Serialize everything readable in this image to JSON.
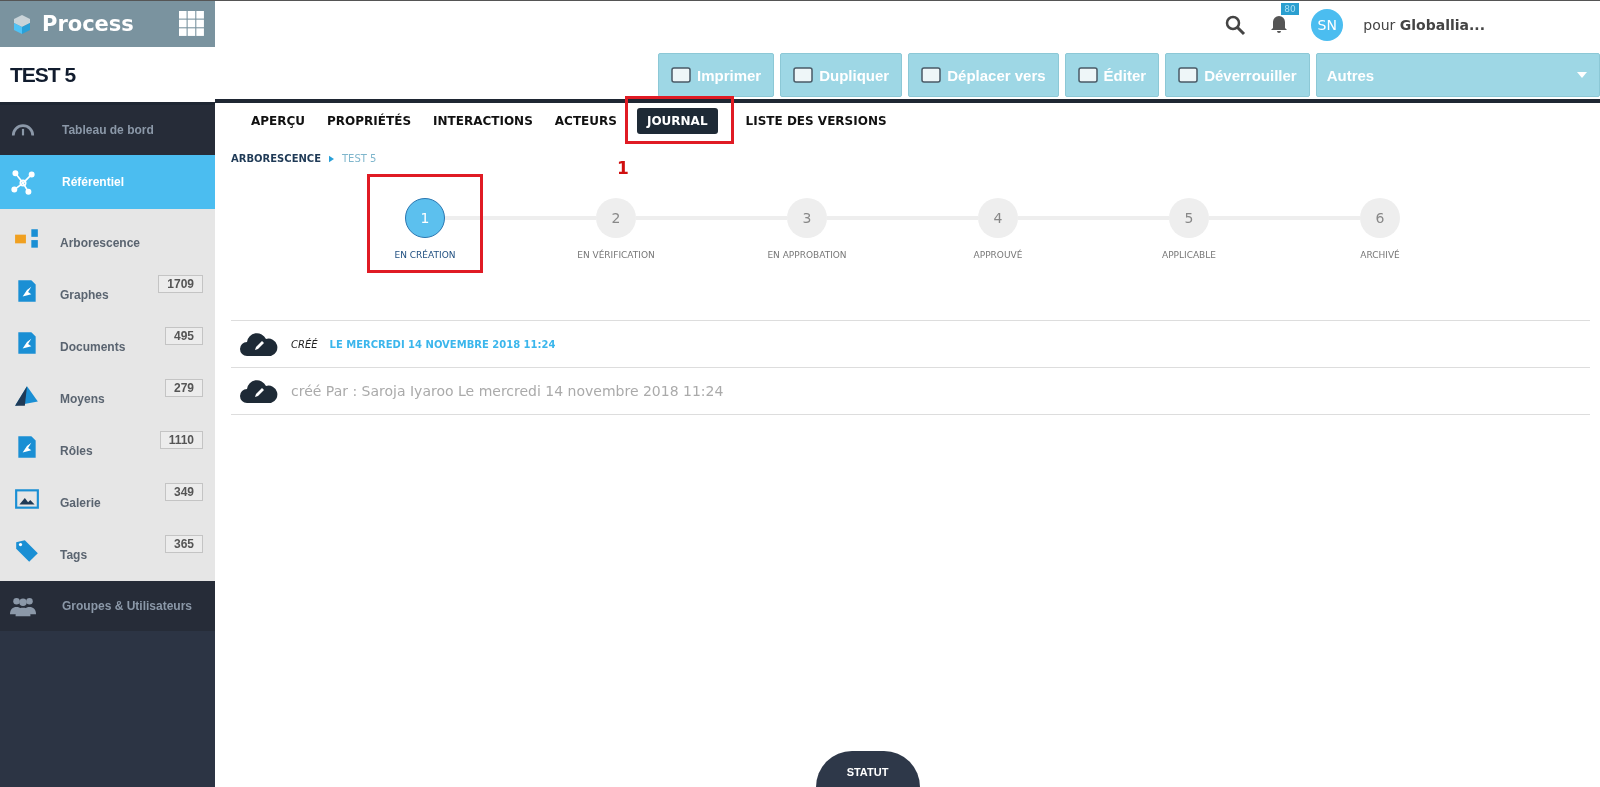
{
  "app": {
    "name": "Process"
  },
  "page_title": "TEST 5",
  "topbar": {
    "notification_count": "80",
    "avatar_initials": "SN",
    "account_prefix": "pour",
    "account_name": "Globallia..."
  },
  "toolbar": [
    "Imprimer",
    "Dupliquer",
    "Déplacer vers",
    "Éditer",
    "Déverrouiller"
  ],
  "more_menu": "Autres",
  "sidebar": {
    "items": [
      {
        "label": "Tableau de bord",
        "selected": false
      },
      {
        "label": "Référentiel",
        "selected": true,
        "children": [
          {
            "label": "Arborescence"
          },
          {
            "label": "Graphes",
            "count": "1709"
          },
          {
            "label": "Documents",
            "count": "495"
          },
          {
            "label": "Moyens",
            "count": "279"
          },
          {
            "label": "Rôles",
            "count": "1110"
          },
          {
            "label": "Galerie",
            "count": "349"
          },
          {
            "label": "Tags",
            "count": "365"
          }
        ]
      },
      {
        "label": "Groupes & Utilisateurs",
        "selected": false
      }
    ]
  },
  "tabs": [
    {
      "label": "APERÇU",
      "selected": false,
      "highlighted": false
    },
    {
      "label": "PROPRIÉTÉS",
      "selected": false,
      "highlighted": false
    },
    {
      "label": "INTERACTIONS",
      "selected": false,
      "highlighted": false
    },
    {
      "label": "ACTEURS",
      "selected": false,
      "highlighted": false
    },
    {
      "label": "JOURNAL",
      "selected": true,
      "highlighted": true
    },
    {
      "label": "LISTE DES VERSIONS",
      "selected": false,
      "highlighted": false
    }
  ],
  "annotation_label": "1",
  "breadcrumb": [
    "ARBORESCENCE",
    "TEST 5"
  ],
  "steps": [
    {
      "number": "1",
      "label": "EN CRÉATION",
      "selected": true,
      "highlighted": true
    },
    {
      "number": "2",
      "label": "EN VÉRIFICATION",
      "selected": false,
      "highlighted": false
    },
    {
      "number": "3",
      "label": "EN APPROBATION",
      "selected": false,
      "highlighted": false
    },
    {
      "number": "4",
      "label": "APPROUVÉ",
      "selected": false,
      "highlighted": false
    },
    {
      "number": "5",
      "label": "APPLICABLE",
      "selected": false,
      "highlighted": false
    },
    {
      "number": "6",
      "label": "ARCHIVÉ",
      "selected": false,
      "highlighted": false
    }
  ],
  "journal": [
    {
      "kind": "summary",
      "action": "CRÉÉ",
      "date": "LE MERCREDI 14 NOVEMBRE 2018 11:24"
    },
    {
      "kind": "detail",
      "text": "créé Par : Saroja Iyaroo Le mercredi 14 novembre 2018 11:24"
    }
  ],
  "status_button": "STATUT"
}
